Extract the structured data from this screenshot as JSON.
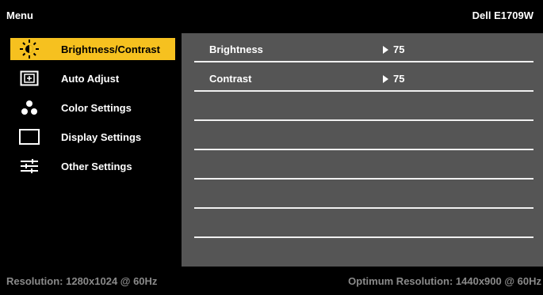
{
  "header": {
    "menu_title": "Menu",
    "model": "Dell E1709W"
  },
  "sidebar": {
    "items": [
      {
        "label": "Brightness/Contrast",
        "icon": "sun-icon",
        "selected": true
      },
      {
        "label": "Auto Adjust",
        "icon": "auto-adjust-icon",
        "selected": false
      },
      {
        "label": "Color Settings",
        "icon": "color-dots-icon",
        "selected": false
      },
      {
        "label": "Display Settings",
        "icon": "display-rectangle-icon",
        "selected": false
      },
      {
        "label": "Other Settings",
        "icon": "sliders-icon",
        "selected": false
      }
    ]
  },
  "panel": {
    "rows": [
      {
        "label": "Brightness",
        "value": "75"
      },
      {
        "label": "Contrast",
        "value": "75"
      },
      {
        "label": "",
        "value": ""
      },
      {
        "label": "",
        "value": ""
      },
      {
        "label": "",
        "value": ""
      },
      {
        "label": "",
        "value": ""
      }
    ]
  },
  "status": {
    "resolution": "Resolution: 1280x1024 @ 60Hz",
    "optimum": "Optimum Resolution: 1440x900 @ 60Hz"
  },
  "colors": {
    "selected_bg": "#f6c11f",
    "panel_bg": "#555555",
    "status_text": "#8a8a8a"
  }
}
